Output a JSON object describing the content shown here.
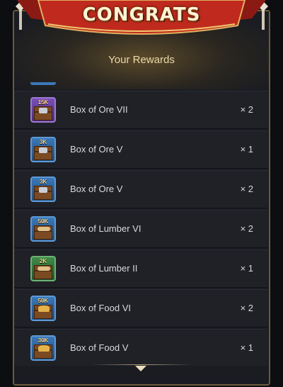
{
  "banner": {
    "title": "CONGRATS"
  },
  "header": {
    "subtitle": "Your Rewards"
  },
  "rewards": [
    {
      "name": "Box of Ore VII",
      "qty": "× 2",
      "amount": "15K",
      "type": "ore",
      "rarity": "purple"
    },
    {
      "name": "Box of Ore V",
      "qty": "× 1",
      "amount": "3K",
      "type": "ore",
      "rarity": "blue"
    },
    {
      "name": "Box of Ore V",
      "qty": "× 2",
      "amount": "3K",
      "type": "ore",
      "rarity": "blue"
    },
    {
      "name": "Box of Lumber VI",
      "qty": "× 2",
      "amount": "50K",
      "type": "lumber",
      "rarity": "blue"
    },
    {
      "name": "Box of Lumber II",
      "qty": "× 1",
      "amount": "2K",
      "type": "lumber",
      "rarity": "green"
    },
    {
      "name": "Box of Food VI",
      "qty": "× 2",
      "amount": "50K",
      "type": "food",
      "rarity": "blue"
    },
    {
      "name": "Box of Food V",
      "qty": "× 1",
      "amount": "30K",
      "type": "food",
      "rarity": "blue"
    }
  ],
  "colors": {
    "banner_red": "#b8261c",
    "gold": "#d4a849",
    "subtitle": "#e8d9a8"
  },
  "icons": {
    "scroll": "chevron-down-icon"
  }
}
